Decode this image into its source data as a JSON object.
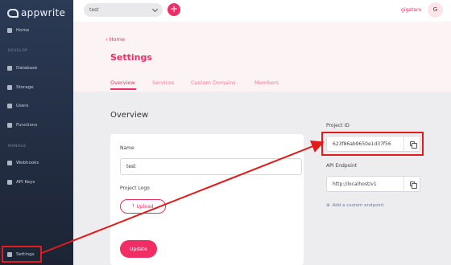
{
  "brand": {
    "name": "appwrite"
  },
  "sidebar": {
    "items": [
      {
        "label": "Home",
        "icon": "home-icon"
      },
      {
        "label": "Database",
        "icon": "database-icon"
      },
      {
        "label": "Storage",
        "icon": "folder-icon"
      },
      {
        "label": "Users",
        "icon": "users-icon"
      },
      {
        "label": "Functions",
        "icon": "bolt-icon"
      },
      {
        "label": "Webhooks",
        "icon": "webhook-icon"
      },
      {
        "label": "API Keys",
        "icon": "key-icon"
      },
      {
        "label": "Settings",
        "icon": "gear-icon"
      }
    ],
    "headings": {
      "develop": "DEVELOP",
      "manage": "MANAGE"
    }
  },
  "topbar": {
    "project": "test",
    "add": "+",
    "username": "gigataro",
    "avatar": "G"
  },
  "header": {
    "breadcrumb": "Home",
    "title": "Settings",
    "tabs": [
      {
        "label": "Overview",
        "active": true
      },
      {
        "label": "Services",
        "active": false
      },
      {
        "label": "Custom Domains",
        "active": false
      },
      {
        "label": "Members",
        "active": false
      }
    ]
  },
  "overview": {
    "title": "Overview",
    "name_label": "Name",
    "name_value": "test",
    "logo_label": "Project Logo",
    "upload_label": "Upload",
    "update_label": "Update"
  },
  "project": {
    "id_label": "Project ID",
    "id_value": "623f86ab9650e1d37f56",
    "endpoint_label": "API Endpoint",
    "endpoint_value": "http://localhost/v1",
    "add_endpoint": "Add a custom endpoint"
  },
  "colors": {
    "accent": "#f02e65",
    "annotation": "#e21b1b",
    "sidebar_top": "#2b3a55",
    "sidebar_bottom": "#1c2434"
  }
}
